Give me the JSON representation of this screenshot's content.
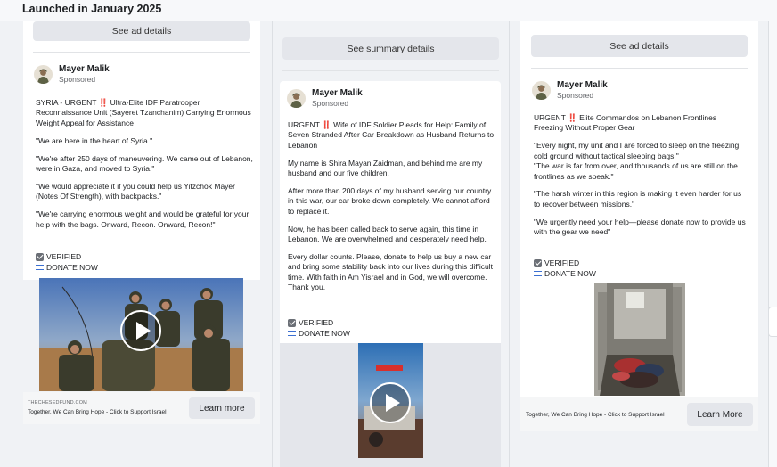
{
  "page": {
    "title": "Launched in January 2025"
  },
  "avatar_icon": "soldier-avatar-icon",
  "ads": [
    {
      "top_button": "See ad details",
      "advertiser": "Mayer Malik",
      "sponsored": "Sponsored",
      "headline_prefix": "SYRIA - URGENT",
      "headline_mark": "‼️",
      "headline_rest": "Ultra-Elite IDF Paratrooper Reconnaissance Unit (Sayeret Tzanchanim) Carrying Enormous Weight Appeal for Assistance",
      "paragraphs": [
        "\"We are here in the heart of Syria.\"",
        "\"We're after 250 days of maneuvering. We came out of Lebanon, were in Gaza, and moved to Syria.\"",
        "\"We would appreciate it if you could help us Yitzchok Mayer (Notes Of Strength), with backpacks.\"",
        "\"We're carrying enormous weight and would be grateful for your help with the bags. Onward, Recon. Onward, Recon!\""
      ],
      "verified": "VERIFIED",
      "donate": "DONATE NOW",
      "media_type": "video",
      "footer_domain": "THECHESEDFUND.COM",
      "footer_tagline": "Together, We Can Bring Hope - Click to Support Israel",
      "cta": "Learn more"
    },
    {
      "top_button": "See summary details",
      "advertiser": "Mayer Malik",
      "sponsored": "Sponsored",
      "headline_prefix": "URGENT",
      "headline_mark": "‼️",
      "headline_rest": "Wife of IDF Soldier Pleads for Help: Family of Seven Stranded After Car Breakdown as Husband Returns to Lebanon",
      "paragraphs": [
        "My name is Shira Mayan Zaidman, and behind me are my husband and our five children.",
        "After more than 200 days of my husband serving our country in this war, our car broke down completely. We cannot afford to replace it.",
        "Now, he has been called back to serve again, this time in Lebanon. We are overwhelmed and desperately need help.",
        "Every dollar counts. Please, donate to help us buy a new car and bring some stability back into our lives during this difficult time. With faith in Am Yisrael and in God, we will overcome. Thank you."
      ],
      "verified": "VERIFIED",
      "donate": "DONATE NOW",
      "media_type": "video"
    },
    {
      "top_button": "See ad details",
      "advertiser": "Mayer Malik",
      "sponsored": "Sponsored",
      "headline_prefix": "URGENT",
      "headline_mark": "‼️",
      "headline_rest": "Elite Commandos on Lebanon Frontlines Freezing Without Proper Gear",
      "paragraphs": [
        "\"Every night, my unit and I are forced to sleep on the freezing cold ground without tactical sleeping bags.\"\n\"The war is far from over, and thousands of us are still on the frontlines as we speak.\"",
        "\"The harsh winter in this region is making it even harder for us to recover between missions.\"",
        "\"We urgently need your help—please donate now to provide us with the gear we need\""
      ],
      "verified": "VERIFIED",
      "donate": "DONATE NOW",
      "media_type": "image",
      "footer_tagline": "Together, We Can Bring Hope - Click to Support Israel",
      "cta": "Learn More"
    }
  ]
}
